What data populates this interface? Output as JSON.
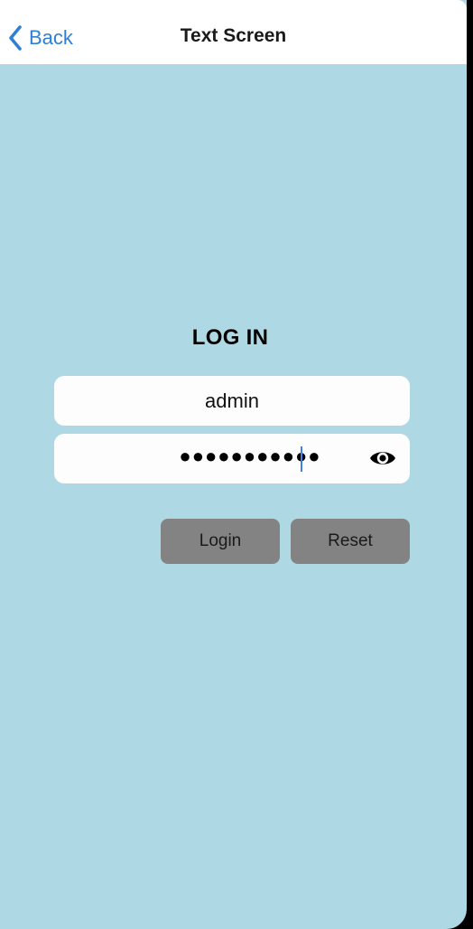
{
  "navbar": {
    "back_label": "Back",
    "title": "Text Screen"
  },
  "login": {
    "heading": "LOG IN",
    "username": {
      "value": "admin"
    },
    "password": {
      "masked_value": "●●●●●●●●●●●",
      "length": 11
    },
    "buttons": {
      "login_label": "Login",
      "reset_label": "Reset"
    }
  },
  "icons": {
    "back": "chevron-left-icon",
    "visibility": "eye-icon"
  },
  "colors": {
    "background": "#afd8e5",
    "navbar": "#ffffff",
    "accent": "#2f7fd4",
    "button": "#838383",
    "field": "#fdfdfd",
    "caret": "#3f7fe8"
  }
}
